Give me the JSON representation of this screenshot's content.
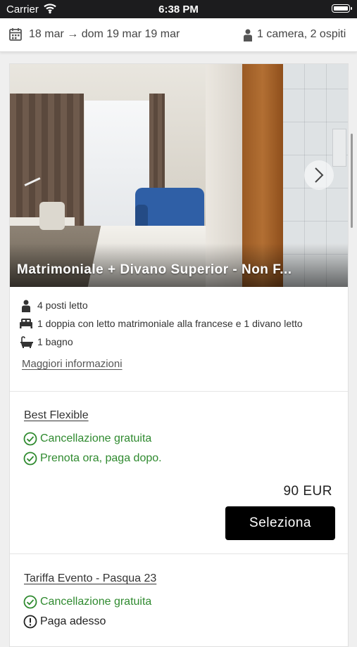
{
  "status_bar": {
    "carrier": "Carrier",
    "time": "6:38 PM"
  },
  "search_bar": {
    "dates": "18 mar → dom 19 mar 19 mar",
    "guests": "1 camera, 2 ospiti",
    "calendar_icon": "calendar-icon",
    "person_icon": "person-icon"
  },
  "room": {
    "name": "Matrimoniale + Divano Superior - Non F...",
    "features": [
      {
        "icon": "person-icon",
        "text": "4 posti letto"
      },
      {
        "icon": "bed-icon",
        "text": "1 doppia con letto matrimoniale alla francese e 1 divano letto"
      },
      {
        "icon": "bathtub-icon",
        "text": "1 bagno"
      }
    ],
    "more_info_label": "Maggiori informazioni"
  },
  "rates": [
    {
      "name": "Best Flexible",
      "perks": [
        {
          "icon": "check-circle-icon",
          "text": "Cancellazione gratuita",
          "color": "#2f8a2f"
        },
        {
          "icon": "check-circle-icon",
          "text": "Prenota ora, paga dopo.",
          "color": "#2f8a2f"
        }
      ],
      "price": "90 EUR",
      "select_label": "Seleziona"
    },
    {
      "name": "Tariffa Evento - Pasqua 23",
      "perks": [
        {
          "icon": "check-circle-icon",
          "text": "Cancellazione gratuita",
          "color": "#2f8a2f"
        },
        {
          "icon": "info-circle-icon",
          "text": "Paga adesso",
          "color": "#222222"
        }
      ]
    }
  ],
  "colors": {
    "accent_green": "#2f8a2f",
    "button_bg": "#000000"
  }
}
